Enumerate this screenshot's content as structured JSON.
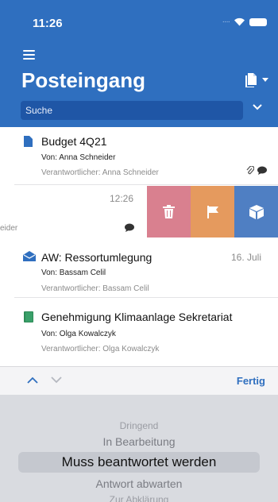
{
  "status_bar": {
    "time": "11:26"
  },
  "header": {
    "title": "Posteingang",
    "search_placeholder": "Suche"
  },
  "mails": [
    {
      "subject": "Budget 4Q21",
      "from": "Von: Anna Schneider",
      "responsible": "Verantwortlicher: Anna Schneider",
      "icon": "document-icon"
    },
    {
      "time": "12:26",
      "partial_text": "eider",
      "icon": "comment-icon"
    },
    {
      "subject": "AW: Ressortumlegung",
      "from": "Von: Bassam Celil",
      "responsible": "Verantwortlicher: Bassam Celil",
      "date": "16. Juli",
      "icon": "open-envelope-icon"
    },
    {
      "subject": "Genehmigung Klimaanlage Sekretariat",
      "from": "Von: Olga Kowalczyk",
      "responsible": "Verantwortlicher: Olga Kowalczyk",
      "icon": "book-icon"
    }
  ],
  "swipe_actions": [
    {
      "name": "delete",
      "icon": "trash-icon",
      "color": "#d9808f"
    },
    {
      "name": "flag",
      "icon": "flag-icon",
      "color": "#e59a5e"
    },
    {
      "name": "move",
      "icon": "box-icon",
      "color": "#4f7fc3"
    }
  ],
  "toolbar": {
    "done_label": "Fertig"
  },
  "picker": {
    "options": [
      "Dringend",
      "In Bearbeitung",
      "Muss beantwortet werden",
      "Antwort abwarten",
      "Zur Abklärung"
    ],
    "selected": "Muss beantwortet werden"
  },
  "colors": {
    "header": "#2f6fbf",
    "search_field": "#1f56a6",
    "accent": "#2f6fbf"
  }
}
